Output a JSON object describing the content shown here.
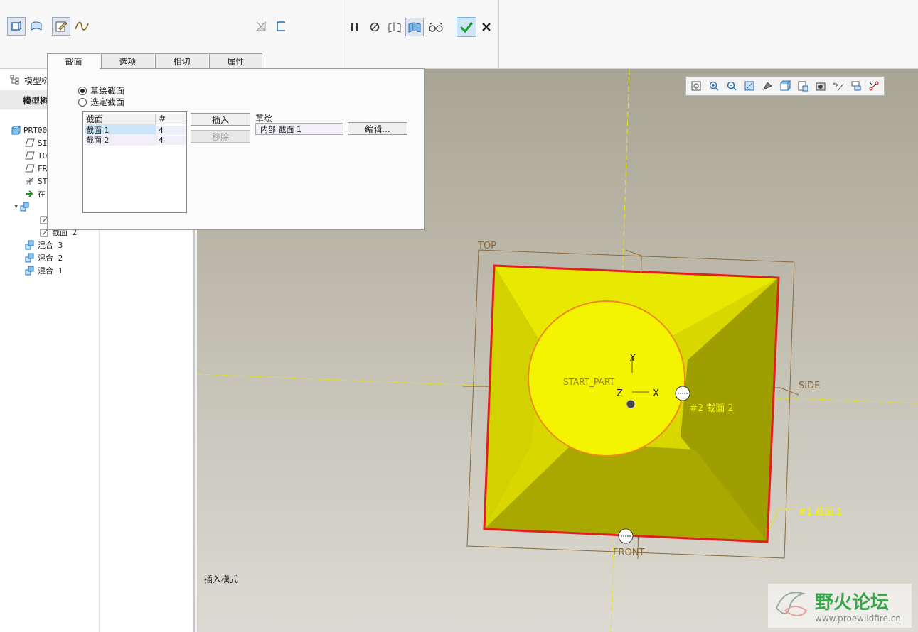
{
  "colors": {
    "accent": "#00a2e8",
    "yellow": "#f4f400",
    "highlight": "#e02020",
    "datum": "#8a6a3a",
    "axis": "#e6e600"
  },
  "ribbon": {
    "icons": [
      "solid-icon",
      "surface-icon",
      "sketch-edit-icon",
      "spline-icon",
      "remove-material-icon",
      "thicken-icon",
      "pause-icon",
      "no-preview-icon",
      "geometry-preview-icon",
      "feature-preview-icon",
      "verify-icon",
      "ok-icon",
      "cancel-icon"
    ],
    "tabs": [
      "截面",
      "选项",
      "相切",
      "属性"
    ]
  },
  "dialog": {
    "radio_sketched": "草绘截面",
    "radio_selected": "选定截面",
    "list_headers": [
      "截面",
      "#"
    ],
    "list_rows": [
      {
        "name": "截面 1",
        "count": "4"
      },
      {
        "name": "截面 2",
        "count": "4"
      }
    ],
    "insert_label": "插入",
    "remove_label": "移除",
    "sketch_label": "草绘",
    "sketch_value": "内部 截面 1",
    "edit_label": "编辑..."
  },
  "tree": {
    "header_icon": "model-tree-icon",
    "header_label": "模型树",
    "sub_header": "模型树",
    "rows": [
      {
        "label": "PRT00",
        "icon": "part-icon"
      },
      {
        "label": "SI",
        "icon": "datum-plane-icon"
      },
      {
        "label": "TO",
        "icon": "datum-plane-icon"
      },
      {
        "label": "FR",
        "icon": "datum-plane-icon"
      },
      {
        "label": "ST",
        "icon": "coord-sys-icon"
      },
      {
        "label": "在",
        "icon": "insert-here-icon"
      },
      {
        "label": "",
        "icon": "blend-icon"
      },
      {
        "label": "",
        "icon": "sketch-icon"
      },
      {
        "label": "截面 2",
        "icon": "sketch-icon"
      },
      {
        "label": "混合 3",
        "icon": "blend-icon"
      },
      {
        "label": "混合 2",
        "icon": "blend-icon"
      },
      {
        "label": "混合 1",
        "icon": "blend-icon"
      }
    ]
  },
  "viewport": {
    "toolbar_icons": [
      "refit-icon",
      "zoom-in-icon",
      "zoom-out-icon",
      "repaint-icon",
      "display-style-icon",
      "saved-views-icon",
      "view-manager-icon",
      "perspective-icon",
      "datum-display-icon",
      "annotation-icon",
      "spin-center-icon"
    ],
    "labels": {
      "top": "TOP",
      "side": "SIDE",
      "front": "FRONT",
      "csys": "START_PART",
      "axis_x": "X",
      "axis_y": "Y",
      "axis_z": "Z",
      "section2": "#2 截面 2",
      "section1": "#1 截面 1"
    }
  },
  "status": {
    "mode": "插入模式"
  },
  "watermark": {
    "title": "野火论坛",
    "url": "www.proewildfire.cn"
  }
}
